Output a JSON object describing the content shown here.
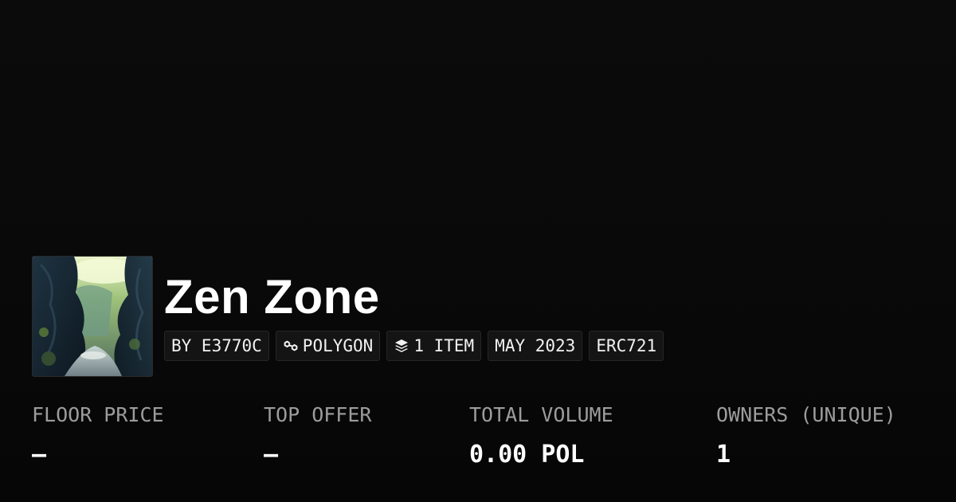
{
  "collection": {
    "title": "Zen Zone",
    "thumbnail_icon": "collection-image-canyon"
  },
  "tags": {
    "creator": "BY E3770C",
    "chain": "POLYGON",
    "chain_icon": "polygon-link-icon",
    "items": "1 ITEM",
    "items_icon": "layers-icon",
    "date": "MAY 2023",
    "standard": "ERC721"
  },
  "stats": {
    "floor_price": {
      "label": "FLOOR PRICE",
      "value": "–"
    },
    "top_offer": {
      "label": "TOP OFFER",
      "value": "–"
    },
    "total_volume": {
      "label": "TOTAL VOLUME",
      "value": "0.00 POL"
    },
    "owners": {
      "label": "OWNERS (UNIQUE)",
      "value": "1"
    }
  },
  "colors": {
    "background": "#0a0a0a",
    "text": "#ffffff",
    "muted": "#9c9c9c",
    "tag_bg": "#141414",
    "tag_border": "#262626"
  }
}
